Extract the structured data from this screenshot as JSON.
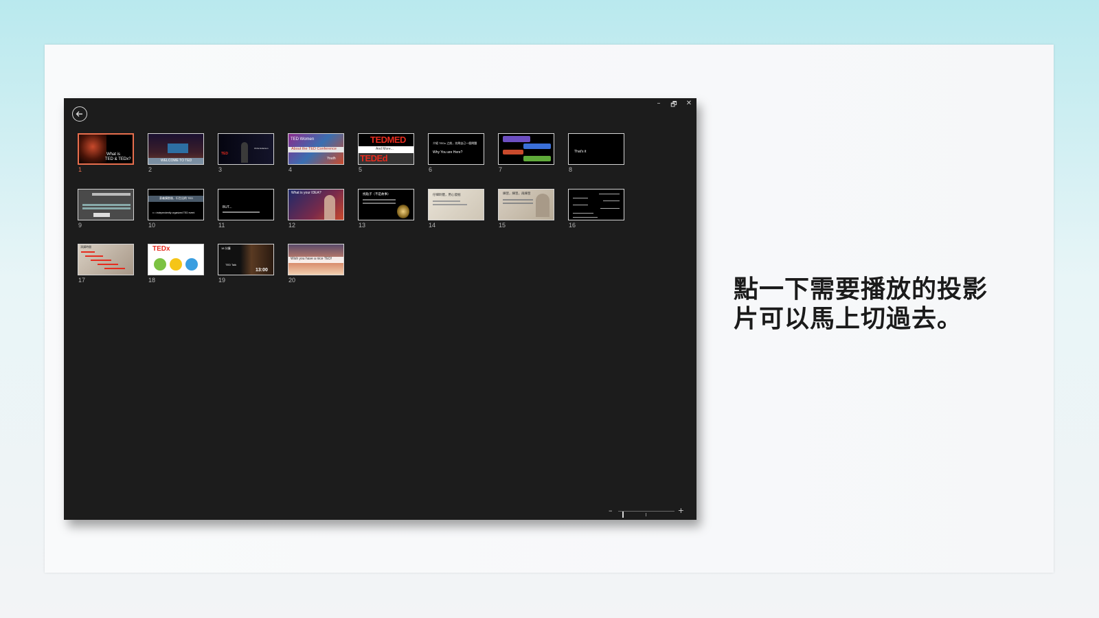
{
  "caption": {
    "line1": "點一下需要播放的投影",
    "line2": "片可以馬上切過去。"
  },
  "window": {
    "controls": [
      "–",
      "🗗",
      "✕"
    ]
  },
  "slides": [
    {
      "num": "1",
      "text1": "What is",
      "text2": "TED & TEDx?",
      "selected": true
    },
    {
      "num": "2",
      "text1": "WELCOME TO TED",
      "text2": ""
    },
    {
      "num": "3",
      "text1": "TED",
      "text2": "Chris Anderson"
    },
    {
      "num": "4",
      "text1": "TED Women",
      "text2": "About the TED Conference",
      "text3": "Youth"
    },
    {
      "num": "5",
      "text1": "TEDMED",
      "text2": "And More...",
      "text3": "TEDEd"
    },
    {
      "num": "6",
      "text1": "介紹 TEDx 之前，先問自己一個問題",
      "text2": "Why You are Here?"
    },
    {
      "num": "7",
      "text1": "",
      "text2": ""
    },
    {
      "num": "8",
      "text1": "That's it",
      "text2": ""
    },
    {
      "num": "9",
      "text1": "",
      "text2": ""
    },
    {
      "num": "10",
      "text1": "意義擴散後，衍生出的 TED",
      "text2": "x = independently organized TED event"
    },
    {
      "num": "11",
      "text1": "BUT...",
      "text2": ""
    },
    {
      "num": "12",
      "text1": "What is your IDEA?",
      "text2": ""
    },
    {
      "num": "13",
      "text1": "找點子（不是故事）",
      "text2": ""
    },
    {
      "num": "14",
      "text1": "仔細聆聽，用心發掘",
      "text2": ""
    },
    {
      "num": "15",
      "text1": "練習，練習，再練習",
      "text2": ""
    },
    {
      "num": "16",
      "text1": "",
      "text2": ""
    },
    {
      "num": "17",
      "text1": "演講時間",
      "text2": ""
    },
    {
      "num": "18",
      "text1": "TEDx",
      "text2": ""
    },
    {
      "num": "19",
      "text1": "18 分鐘",
      "text2": "13:00",
      "text3": "TED Talk"
    },
    {
      "num": "20",
      "text1": "Wish you have a nice TED!",
      "text2": ""
    }
  ],
  "colors": {
    "selected_border": "#e96f4e",
    "window_bg": "#1c1c1c",
    "ted_red": "#e62b1e"
  },
  "zoom": {
    "minus": "–",
    "plus": "+"
  }
}
